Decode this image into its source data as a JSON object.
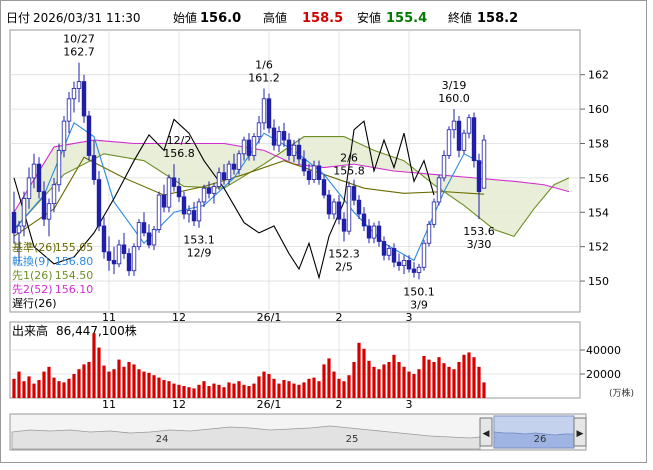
{
  "header": {
    "date_label": "日付",
    "date_value": "2026/03/31 11:30",
    "open_label": "始値",
    "open_value": "156.0",
    "high_label": "高値",
    "high_value": "158.5",
    "low_label": "安値",
    "low_value": "155.4",
    "close_label": "終値",
    "close_value": "158.2"
  },
  "colors": {
    "high": "#d40000",
    "low": "#007a00",
    "candle": "#1f1fa8",
    "volume": "#d40000",
    "base_line": "#6b6b00",
    "conversion_line": "#2b8be0",
    "span1": "#6f8f25",
    "span2": "#d22dd2",
    "lagging": "#000000",
    "cloud": "#e6ecd3"
  },
  "indicators": [
    {
      "label": "基準(26)",
      "value": "155.05",
      "color": "#6b6b00"
    },
    {
      "label": "転換(9)",
      "value": "156.80",
      "color": "#2b8be0"
    },
    {
      "label": "先1(26)",
      "value": "154.50",
      "color": "#6f8f25"
    },
    {
      "label": "先2(52)",
      "value": "156.10",
      "color": "#d22dd2"
    },
    {
      "label": "遅行(26)",
      "value": "",
      "color": "#000000"
    }
  ],
  "volume_panel": {
    "title": "出来高",
    "value": "86,447,100株",
    "unit": "(万株)"
  },
  "navigator": {
    "labels": [
      "24",
      "25",
      "26"
    ],
    "left_arrow": "◀",
    "right_arrow": "▶"
  },
  "chart_data": {
    "type": "candlestick",
    "price_axis": {
      "ylim": [
        148.2,
        164.6
      ],
      "ticks": [
        150,
        152,
        154,
        156,
        158,
        160,
        162
      ]
    },
    "volume_axis": {
      "ylim": [
        0,
        55000
      ],
      "ticks": [
        20000,
        40000
      ],
      "unit": "万株"
    },
    "x_tick_labels": [
      {
        "label": "11",
        "index": 19
      },
      {
        "label": "12",
        "index": 33
      },
      {
        "label": "26/1",
        "index": 51
      },
      {
        "label": "2",
        "index": 65
      },
      {
        "label": "3",
        "index": 79
      }
    ],
    "annotations": [
      {
        "date": "10/27",
        "value": "162.7",
        "index": 13,
        "type": "high"
      },
      {
        "date": "12/2",
        "value": "156.8",
        "index": 33,
        "type": "high"
      },
      {
        "date": "1/6",
        "value": "161.2",
        "index": 50,
        "type": "high"
      },
      {
        "date": "12/9",
        "value": "153.1",
        "index": 37,
        "type": "low"
      },
      {
        "date": "2/6",
        "value": "155.8",
        "index": 67,
        "type": "high"
      },
      {
        "date": "2/5",
        "value": "152.3",
        "index": 66,
        "type": "low"
      },
      {
        "date": "3/19",
        "value": "160.0",
        "index": 88,
        "type": "high"
      },
      {
        "date": "3/9",
        "value": "150.1",
        "index": 81,
        "type": "low"
      },
      {
        "date": "3/30",
        "value": "153.6",
        "index": 93,
        "type": "low"
      }
    ],
    "ohlc": [
      [
        154.0,
        155.2,
        152.2,
        152.8
      ],
      [
        152.8,
        153.5,
        151.0,
        153.2
      ],
      [
        153.2,
        155.2,
        152.6,
        154.8
      ],
      [
        154.8,
        156.6,
        154.2,
        156.0
      ],
      [
        156.0,
        157.4,
        155.4,
        156.8
      ],
      [
        156.8,
        157.2,
        154.8,
        155.2
      ],
      [
        155.2,
        155.8,
        153.2,
        153.6
      ],
      [
        153.6,
        154.8,
        152.6,
        154.5
      ],
      [
        154.5,
        156.0,
        154.0,
        155.6
      ],
      [
        155.6,
        158.0,
        155.2,
        157.6
      ],
      [
        157.6,
        159.6,
        157.2,
        159.3
      ],
      [
        159.3,
        161.0,
        158.6,
        160.6
      ],
      [
        160.6,
        161.6,
        159.8,
        161.2
      ],
      [
        161.2,
        162.7,
        160.4,
        161.6
      ],
      [
        161.6,
        162.0,
        159.2,
        159.6
      ],
      [
        159.6,
        159.9,
        157.0,
        157.3
      ],
      [
        157.3,
        158.2,
        155.6,
        155.9
      ],
      [
        155.9,
        156.4,
        152.9,
        153.2
      ],
      [
        153.2,
        153.7,
        151.3,
        151.7
      ],
      [
        151.7,
        152.6,
        150.6,
        151.2
      ],
      [
        151.2,
        152.0,
        150.4,
        151.0
      ],
      [
        151.0,
        152.4,
        150.8,
        152.1
      ],
      [
        152.1,
        152.8,
        151.3,
        151.6
      ],
      [
        151.6,
        151.9,
        150.3,
        150.6
      ],
      [
        150.6,
        152.2,
        150.3,
        152.0
      ],
      [
        152.0,
        153.6,
        151.8,
        153.4
      ],
      [
        153.4,
        154.0,
        152.6,
        152.8
      ],
      [
        152.8,
        153.3,
        151.9,
        152.1
      ],
      [
        152.1,
        153.2,
        151.8,
        153.0
      ],
      [
        153.0,
        155.2,
        152.8,
        155.0
      ],
      [
        155.0,
        155.6,
        154.0,
        154.3
      ],
      [
        154.3,
        156.2,
        154.0,
        156.0
      ],
      [
        156.0,
        156.8,
        155.2,
        155.5
      ],
      [
        155.5,
        156.0,
        154.6,
        154.9
      ],
      [
        154.9,
        155.2,
        153.6,
        153.9
      ],
      [
        153.9,
        154.4,
        153.4,
        154.1
      ],
      [
        154.1,
        154.6,
        153.2,
        153.5
      ],
      [
        153.5,
        154.8,
        153.1,
        154.6
      ],
      [
        154.6,
        155.6,
        154.3,
        155.4
      ],
      [
        155.4,
        155.8,
        154.8,
        155.1
      ],
      [
        155.1,
        155.7,
        154.5,
        155.5
      ],
      [
        155.5,
        156.6,
        155.3,
        156.3
      ],
      [
        156.3,
        156.8,
        155.6,
        155.9
      ],
      [
        155.9,
        157.0,
        155.6,
        156.8
      ],
      [
        156.8,
        157.4,
        156.2,
        156.5
      ],
      [
        156.5,
        157.6,
        156.2,
        157.4
      ],
      [
        157.4,
        158.4,
        157.0,
        158.2
      ],
      [
        158.2,
        158.6,
        157.0,
        157.3
      ],
      [
        157.3,
        158.6,
        157.0,
        158.4
      ],
      [
        158.4,
        159.6,
        158.0,
        159.2
      ],
      [
        159.2,
        161.2,
        158.8,
        160.6
      ],
      [
        160.6,
        160.9,
        158.6,
        158.9
      ],
      [
        158.9,
        159.4,
        157.6,
        157.9
      ],
      [
        157.9,
        159.0,
        157.5,
        158.7
      ],
      [
        158.7,
        159.2,
        157.8,
        158.2
      ],
      [
        158.2,
        158.6,
        157.0,
        157.3
      ],
      [
        157.3,
        158.2,
        156.9,
        157.9
      ],
      [
        157.9,
        158.3,
        156.8,
        157.1
      ],
      [
        157.1,
        157.6,
        156.1,
        156.4
      ],
      [
        156.4,
        156.8,
        155.6,
        155.9
      ],
      [
        155.9,
        157.0,
        155.7,
        156.7
      ],
      [
        156.7,
        157.0,
        155.6,
        155.9
      ],
      [
        155.9,
        156.2,
        154.8,
        155.0
      ],
      [
        155.0,
        155.3,
        153.6,
        153.9
      ],
      [
        153.9,
        154.8,
        153.6,
        154.6
      ],
      [
        154.6,
        155.0,
        153.3,
        153.6
      ],
      [
        153.6,
        154.0,
        152.3,
        152.9
      ],
      [
        152.9,
        155.8,
        152.7,
        155.5
      ],
      [
        155.5,
        155.9,
        154.4,
        154.7
      ],
      [
        154.7,
        155.0,
        153.6,
        153.9
      ],
      [
        153.9,
        154.3,
        152.9,
        153.2
      ],
      [
        153.2,
        153.6,
        152.2,
        152.5
      ],
      [
        152.5,
        153.4,
        152.2,
        153.2
      ],
      [
        153.2,
        153.5,
        152.0,
        152.3
      ],
      [
        152.3,
        152.6,
        151.2,
        151.5
      ],
      [
        151.5,
        152.1,
        151.2,
        151.9
      ],
      [
        151.9,
        152.2,
        150.8,
        151.1
      ],
      [
        151.1,
        151.6,
        150.6,
        150.9
      ],
      [
        150.9,
        151.5,
        150.4,
        151.2
      ],
      [
        151.2,
        151.5,
        150.5,
        150.7
      ],
      [
        150.7,
        151.1,
        150.2,
        150.5
      ],
      [
        150.5,
        151.0,
        150.1,
        150.8
      ],
      [
        150.8,
        152.4,
        150.6,
        152.2
      ],
      [
        152.2,
        153.5,
        152.0,
        153.3
      ],
      [
        153.3,
        154.8,
        153.1,
        154.6
      ],
      [
        154.6,
        156.2,
        154.4,
        156.0
      ],
      [
        156.0,
        157.6,
        155.8,
        157.3
      ],
      [
        157.3,
        159.0,
        157.1,
        158.8
      ],
      [
        158.8,
        160.0,
        158.3,
        159.3
      ],
      [
        159.3,
        159.6,
        157.2,
        157.6
      ],
      [
        157.6,
        158.8,
        157.4,
        158.6
      ],
      [
        158.6,
        159.7,
        158.3,
        159.5
      ],
      [
        159.5,
        159.8,
        156.6,
        157.0
      ],
      [
        157.0,
        157.4,
        153.6,
        155.2
      ],
      [
        155.4,
        158.5,
        155.4,
        158.2
      ]
    ],
    "volume": [
      16000,
      22000,
      14000,
      18000,
      12000,
      15000,
      22000,
      26000,
      17000,
      14000,
      13000,
      16000,
      20000,
      24000,
      28000,
      30000,
      54000,
      42000,
      27000,
      22000,
      24000,
      32000,
      26000,
      30000,
      28000,
      24000,
      22000,
      21000,
      19000,
      17000,
      15000,
      14000,
      12000,
      11000,
      10000,
      9000,
      8000,
      11000,
      14000,
      10000,
      12000,
      11000,
      9000,
      13000,
      12000,
      14000,
      11000,
      10000,
      12000,
      18000,
      22000,
      20000,
      16000,
      12000,
      15000,
      14000,
      12000,
      11000,
      13000,
      16000,
      17000,
      14000,
      28000,
      33000,
      22000,
      16000,
      14000,
      19000,
      30000,
      46000,
      41000,
      31000,
      26000,
      24000,
      28000,
      30000,
      36000,
      30000,
      26000,
      22000,
      20000,
      24000,
      35000,
      32000,
      30000,
      34000,
      29000,
      26000,
      24000,
      30000,
      36000,
      38000,
      34000,
      26000,
      13000
    ],
    "lines": {
      "base": [
        {
          "i": 0,
          "v": 152.6
        },
        {
          "i": 8,
          "v": 154.2
        },
        {
          "i": 14,
          "v": 157.2
        },
        {
          "i": 22,
          "v": 156.0
        },
        {
          "i": 30,
          "v": 155.0
        },
        {
          "i": 38,
          "v": 155.5
        },
        {
          "i": 46,
          "v": 156.2
        },
        {
          "i": 54,
          "v": 157.0
        },
        {
          "i": 62,
          "v": 156.2
        },
        {
          "i": 70,
          "v": 155.4
        },
        {
          "i": 78,
          "v": 155.1
        },
        {
          "i": 86,
          "v": 155.2
        },
        {
          "i": 94,
          "v": 155.05
        }
      ],
      "conversion": [
        {
          "i": 0,
          "v": 153.0
        },
        {
          "i": 6,
          "v": 155.0
        },
        {
          "i": 12,
          "v": 159.2
        },
        {
          "i": 16,
          "v": 158.4
        },
        {
          "i": 20,
          "v": 154.6
        },
        {
          "i": 26,
          "v": 152.2
        },
        {
          "i": 32,
          "v": 154.0
        },
        {
          "i": 38,
          "v": 154.4
        },
        {
          "i": 44,
          "v": 156.0
        },
        {
          "i": 50,
          "v": 158.6
        },
        {
          "i": 56,
          "v": 157.6
        },
        {
          "i": 62,
          "v": 156.2
        },
        {
          "i": 68,
          "v": 154.0
        },
        {
          "i": 74,
          "v": 152.2
        },
        {
          "i": 80,
          "v": 151.2
        },
        {
          "i": 86,
          "v": 155.2
        },
        {
          "i": 90,
          "v": 157.4
        },
        {
          "i": 94,
          "v": 156.8
        }
      ],
      "span1": [
        {
          "i": 0,
          "v": 153.0
        },
        {
          "i": 10,
          "v": 156.2
        },
        {
          "i": 18,
          "v": 157.4
        },
        {
          "i": 26,
          "v": 157.0
        },
        {
          "i": 34,
          "v": 155.5
        },
        {
          "i": 42,
          "v": 155.4
        },
        {
          "i": 50,
          "v": 156.8
        },
        {
          "i": 58,
          "v": 158.4
        },
        {
          "i": 66,
          "v": 158.4
        },
        {
          "i": 72,
          "v": 157.6
        },
        {
          "i": 78,
          "v": 157.0
        },
        {
          "i": 84,
          "v": 155.6
        },
        {
          "i": 90,
          "v": 154.4
        },
        {
          "i": 96,
          "v": 153.0
        },
        {
          "i": 100,
          "v": 152.6
        },
        {
          "i": 104,
          "v": 154.2
        },
        {
          "i": 108,
          "v": 155.6
        },
        {
          "i": 111,
          "v": 156.0
        }
      ],
      "span2": [
        {
          "i": 0,
          "v": 154.0
        },
        {
          "i": 8,
          "v": 157.8
        },
        {
          "i": 16,
          "v": 158.2
        },
        {
          "i": 24,
          "v": 158.0
        },
        {
          "i": 34,
          "v": 158.0
        },
        {
          "i": 42,
          "v": 158.0
        },
        {
          "i": 50,
          "v": 157.6
        },
        {
          "i": 56,
          "v": 156.8
        },
        {
          "i": 62,
          "v": 156.6
        },
        {
          "i": 68,
          "v": 156.8
        },
        {
          "i": 76,
          "v": 156.4
        },
        {
          "i": 84,
          "v": 156.2
        },
        {
          "i": 92,
          "v": 156.0
        },
        {
          "i": 100,
          "v": 155.8
        },
        {
          "i": 106,
          "v": 155.6
        },
        {
          "i": 111,
          "v": 155.2
        }
      ],
      "lagging": [
        {
          "i": 0,
          "v": 156.0
        },
        {
          "i": 4,
          "v": 152.0
        },
        {
          "i": 8,
          "v": 151.0
        },
        {
          "i": 12,
          "v": 151.4
        },
        {
          "i": 16,
          "v": 152.8
        },
        {
          "i": 20,
          "v": 154.8
        },
        {
          "i": 24,
          "v": 157.0
        },
        {
          "i": 27,
          "v": 158.5
        },
        {
          "i": 30,
          "v": 157.6
        },
        {
          "i": 32,
          "v": 159.4
        },
        {
          "i": 35,
          "v": 158.6
        },
        {
          "i": 38,
          "v": 157.0
        },
        {
          "i": 42,
          "v": 155.4
        },
        {
          "i": 46,
          "v": 153.4
        },
        {
          "i": 49,
          "v": 152.8
        },
        {
          "i": 52,
          "v": 153.2
        },
        {
          "i": 55,
          "v": 151.6
        },
        {
          "i": 57,
          "v": 150.7
        },
        {
          "i": 59,
          "v": 152.2
        },
        {
          "i": 61,
          "v": 150.2
        },
        {
          "i": 63,
          "v": 152.6
        },
        {
          "i": 66,
          "v": 154.6
        },
        {
          "i": 68,
          "v": 158.8
        },
        {
          "i": 70,
          "v": 159.3
        },
        {
          "i": 72,
          "v": 156.4
        },
        {
          "i": 74,
          "v": 158.2
        },
        {
          "i": 76,
          "v": 156.6
        },
        {
          "i": 78,
          "v": 158.6
        },
        {
          "i": 80,
          "v": 155.8
        },
        {
          "i": 82,
          "v": 157.0
        },
        {
          "i": 84,
          "v": 155.0
        }
      ]
    }
  }
}
